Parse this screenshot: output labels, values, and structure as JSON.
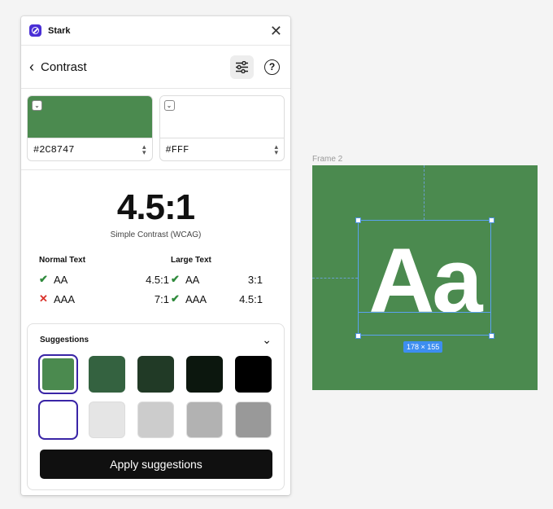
{
  "app": {
    "name": "Stark"
  },
  "header": {
    "title": "Contrast"
  },
  "foreground": {
    "hex": "#2C8747",
    "swatch": "#4b8a4f"
  },
  "background": {
    "hex": "#FFF",
    "swatch": "#ffffff"
  },
  "result": {
    "ratio": "4.5:1",
    "method": "Simple Contrast (WCAG)"
  },
  "normal_text": {
    "title": "Normal Text",
    "rows": [
      {
        "level": "AA",
        "value": "4.5:1",
        "pass": true
      },
      {
        "level": "AAA",
        "value": "7:1",
        "pass": false
      }
    ]
  },
  "large_text": {
    "title": "Large Text",
    "rows": [
      {
        "level": "AA",
        "value": "3:1",
        "pass": true
      },
      {
        "level": "AAA",
        "value": "4.5:1",
        "pass": true
      }
    ]
  },
  "suggestions": {
    "title": "Suggestions",
    "apply_label": "Apply suggestions",
    "row1": [
      "#4b8a4f",
      "#346240",
      "#213a26",
      "#0c170e",
      "#000000"
    ],
    "row2": [
      "#ffffff",
      "#e5e5e5",
      "#cccccc",
      "#b2b2b2",
      "#999999"
    ]
  },
  "canvas": {
    "frame_label": "Frame 2",
    "frame_color": "#4b8a4f",
    "sample_text": "Aa",
    "dimensions": "178 × 155"
  }
}
